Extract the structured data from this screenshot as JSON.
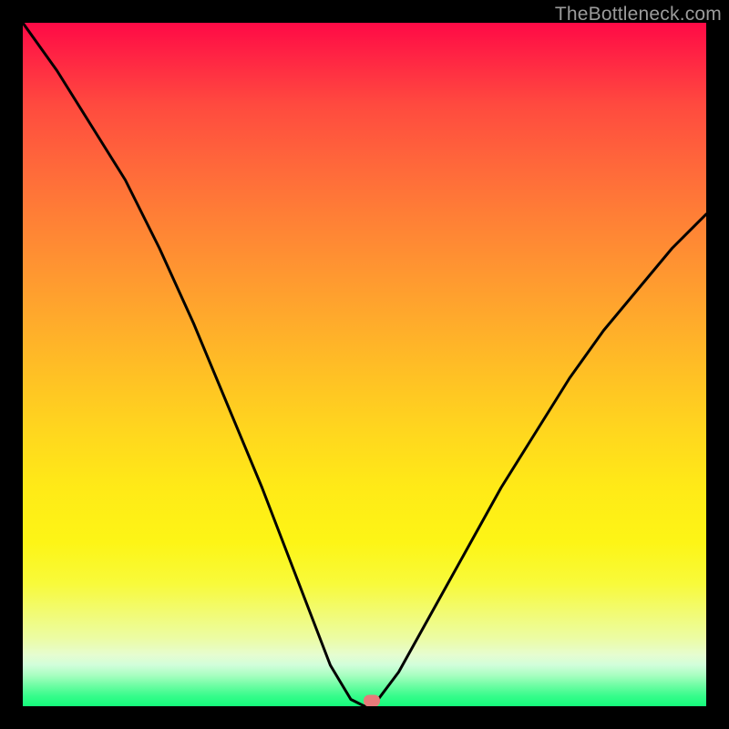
{
  "watermark": "TheBottleneck.com",
  "marker": {
    "color": "#e77a7a",
    "x_frac": 0.51,
    "y_frac": 0.992
  },
  "chart_data": {
    "type": "line",
    "title": "",
    "xlabel": "",
    "ylabel": "",
    "xlim": [
      0,
      100
    ],
    "ylim": [
      0,
      100
    ],
    "series": [
      {
        "name": "bottleneck-curve",
        "x": [
          0,
          5,
          10,
          15,
          20,
          25,
          30,
          35,
          40,
          45,
          48,
          50,
          52,
          55,
          60,
          65,
          70,
          75,
          80,
          85,
          90,
          95,
          100
        ],
        "y": [
          100,
          93,
          85,
          77,
          67,
          56,
          44,
          32,
          19,
          6,
          1,
          0,
          1,
          5,
          14,
          23,
          32,
          40,
          48,
          55,
          61,
          67,
          72
        ]
      }
    ],
    "background_gradient": {
      "direction": "vertical",
      "stops": [
        {
          "pos": 0.0,
          "color": "#ff0a46"
        },
        {
          "pos": 0.2,
          "color": "#ff653b"
        },
        {
          "pos": 0.44,
          "color": "#ffac2b"
        },
        {
          "pos": 0.68,
          "color": "#ffea17"
        },
        {
          "pos": 0.86,
          "color": "#f2fb6f"
        },
        {
          "pos": 0.94,
          "color": "#d0feda"
        },
        {
          "pos": 1.0,
          "color": "#14fb7b"
        }
      ]
    },
    "optimum_x": 51.0
  }
}
